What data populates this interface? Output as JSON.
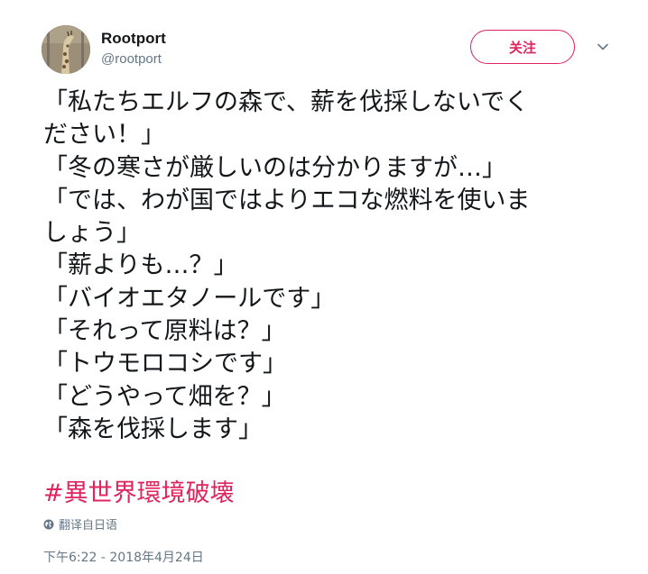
{
  "author": {
    "name": "Rootport",
    "handle": "@rootport"
  },
  "follow_label": "关注",
  "tweet_lines": [
    "「私たちエルフの森で、薪を伐採しないでく",
    "ださい！」",
    "「冬の寒さが厳しいのは分かりますが…」",
    "「では、わが国ではよりエコな燃料を使いま",
    "しょう」",
    "「薪よりも…？」",
    "「バイオエタノールです」",
    "「それって原料は？」",
    "「トウモロコシです」",
    "「どうやって畑を？」",
    "「森を伐採します」"
  ],
  "hashtag": "#異世界環境破壊",
  "translate_label": "翻译自日语",
  "timestamp": "下午6:22 - 2018年4月24日",
  "colors": {
    "accent": "#e0245e",
    "text": "#14171a",
    "muted": "#657786"
  },
  "icons": {
    "avatar": "giraffe-avatar",
    "caret": "chevron-down-icon",
    "globe": "globe-icon"
  }
}
